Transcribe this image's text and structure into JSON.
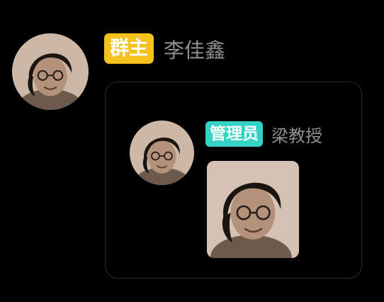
{
  "owner_message": {
    "role_badge": "群主",
    "sender_name": "李佳鑫",
    "avatar_icon": "user-avatar-portrait"
  },
  "forwarded_message": {
    "role_badge": "管理员",
    "sender_name": "梁教授",
    "avatar_icon": "user-avatar-portrait",
    "image_icon": "portrait-photo"
  },
  "colors": {
    "background": "#000000",
    "owner_badge": "#f6c21e",
    "admin_badge": "#35d2c6",
    "name_text": "#8f8f8f",
    "card_border": "#2b2b2b"
  }
}
